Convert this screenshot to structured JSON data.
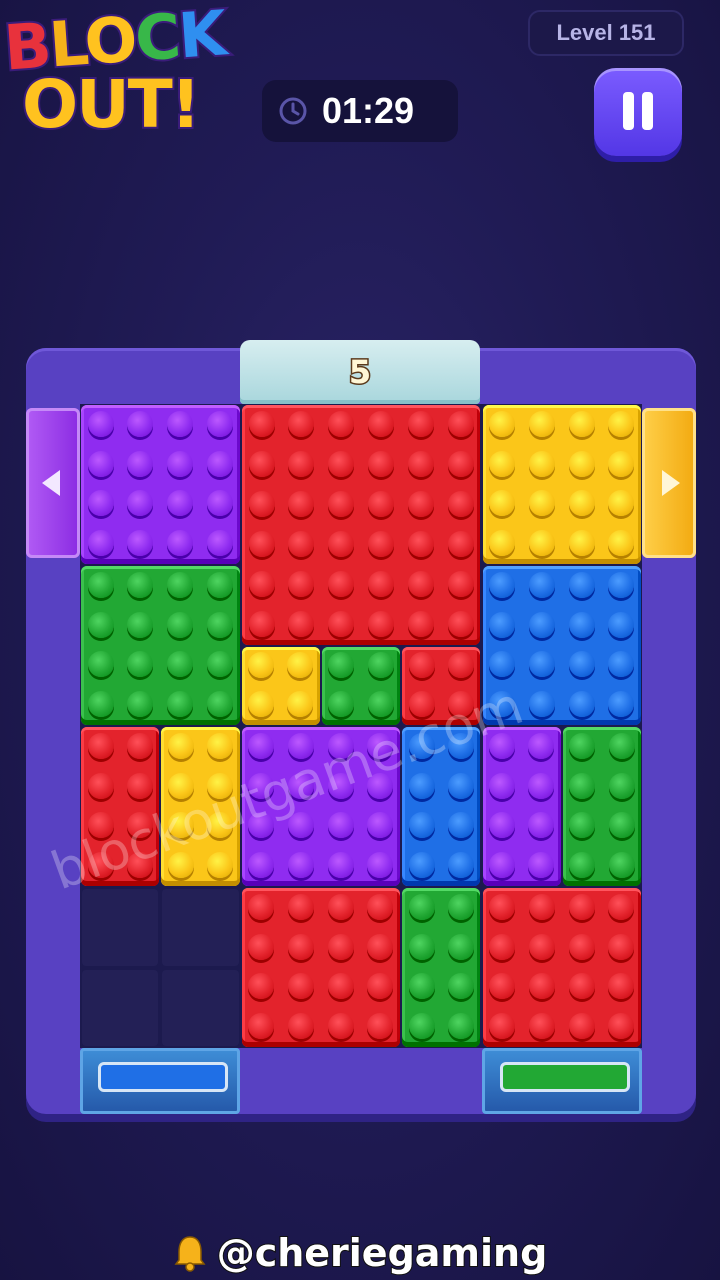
{
  "header": {
    "logo_line1": [
      "B",
      "L",
      "O",
      "C",
      "K"
    ],
    "logo_line2": "OUT!",
    "level_label": "Level 151",
    "timer": "01:29"
  },
  "board": {
    "cols": 7,
    "rows": 8,
    "exit_count": "5",
    "colors": {
      "purple": "#8f2cf0",
      "red": "#e3232c",
      "yellow": "#fbc619",
      "green": "#22a834",
      "blue": "#1f6fe6"
    },
    "blocks": [
      {
        "color": "purple",
        "col": 0,
        "row": 0,
        "w": 2,
        "h": 2
      },
      {
        "color": "red",
        "col": 2,
        "row": 0,
        "w": 3,
        "h": 3
      },
      {
        "color": "yellow",
        "col": 5,
        "row": 0,
        "w": 2,
        "h": 2
      },
      {
        "color": "green",
        "col": 0,
        "row": 2,
        "w": 2,
        "h": 2
      },
      {
        "color": "blue",
        "col": 5,
        "row": 2,
        "w": 2,
        "h": 2
      },
      {
        "color": "yellow",
        "col": 2,
        "row": 3,
        "w": 1,
        "h": 1
      },
      {
        "color": "green",
        "col": 3,
        "row": 3,
        "w": 1,
        "h": 1
      },
      {
        "color": "red",
        "col": 4,
        "row": 3,
        "w": 1,
        "h": 1
      },
      {
        "color": "red",
        "col": 0,
        "row": 4,
        "w": 1,
        "h": 2
      },
      {
        "color": "yellow",
        "col": 1,
        "row": 4,
        "w": 1,
        "h": 2
      },
      {
        "color": "purple",
        "col": 2,
        "row": 4,
        "w": 2,
        "h": 2
      },
      {
        "color": "blue",
        "col": 4,
        "row": 4,
        "w": 1,
        "h": 2
      },
      {
        "color": "purple",
        "col": 5,
        "row": 4,
        "w": 1,
        "h": 2
      },
      {
        "color": "green",
        "col": 6,
        "row": 4,
        "w": 1,
        "h": 2
      },
      {
        "color": "red",
        "col": 2,
        "row": 6,
        "w": 2,
        "h": 2
      },
      {
        "color": "green",
        "col": 4,
        "row": 6,
        "w": 1,
        "h": 2
      },
      {
        "color": "red",
        "col": 5,
        "row": 6,
        "w": 2,
        "h": 2
      }
    ],
    "empty_cells": [
      {
        "col": 0,
        "row": 6
      },
      {
        "col": 1,
        "row": 6
      },
      {
        "col": 0,
        "row": 7
      },
      {
        "col": 1,
        "row": 7
      }
    ],
    "gates": {
      "left": {
        "color": "purple",
        "arrow": "left"
      },
      "right": {
        "color": "yellow",
        "arrow": "right"
      },
      "bottom_left": {
        "color": "blue"
      },
      "bottom_right": {
        "color": "green"
      }
    }
  },
  "watermark": "blockoutgame.com",
  "footer": {
    "handle": "@cheriegaming",
    "icon": "bell-icon"
  }
}
